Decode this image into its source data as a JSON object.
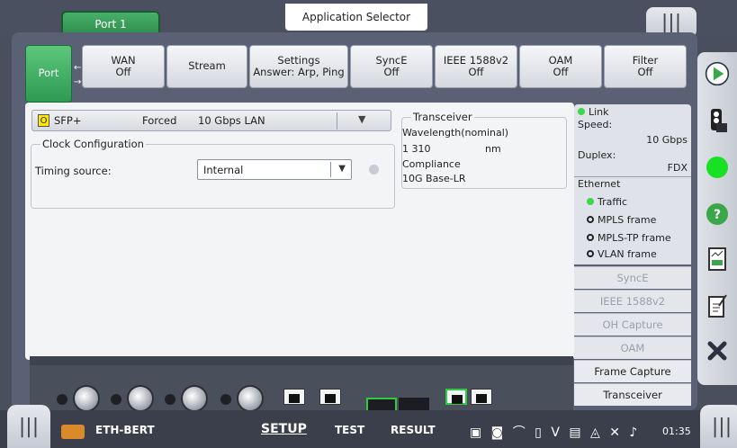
{
  "header": {
    "port_tab": "Port 1",
    "app_selector": "Application Selector"
  },
  "tabs": [
    {
      "line1": "Port",
      "line2": ""
    },
    {
      "line1": "WAN",
      "line2": "Off"
    },
    {
      "line1": "Stream",
      "line2": ""
    },
    {
      "line1": "Settings",
      "line2": "Answer: Arp, Ping"
    },
    {
      "line1": "SyncE",
      "line2": "Off"
    },
    {
      "line1": "IEEE 1588v2",
      "line2": "Off"
    },
    {
      "line1": "OAM",
      "line2": "Off"
    },
    {
      "line1": "Filter",
      "line2": "Off"
    }
  ],
  "sfp": {
    "indicator": "O",
    "type": "SFP+",
    "mode": "Forced",
    "rate": "10 Gbps LAN"
  },
  "clock": {
    "title": "Clock Configuration",
    "timing_label": "Timing source:",
    "timing_value": "Internal"
  },
  "transceiver": {
    "title": "Transceiver",
    "wavelength_label": "Wavelength(nominal)",
    "wavelength_value": "1 310",
    "wavelength_unit": "nm",
    "compliance_label": "Compliance",
    "compliance_value": "10G Base-LR"
  },
  "status": {
    "link": "Link",
    "speed_label": "Speed:",
    "speed_value": "10 Gbps",
    "duplex_label": "Duplex:",
    "duplex_value": "FDX",
    "ethernet": "Ethernet",
    "traffic": "Traffic",
    "mpls": "MPLS frame",
    "mpls_tp": "MPLS-TP frame",
    "vlan": "VLAN frame"
  },
  "side_buttons": [
    "SyncE",
    "IEEE 1588v2",
    "OH Capture",
    "OAM",
    "Frame Capture",
    "Transceiver"
  ],
  "bottom": {
    "app_name": "ETH-BERT",
    "setup": "SETUP",
    "test": "TEST",
    "result": "RESULT",
    "time": "01:35"
  },
  "colors": {
    "accent_green": "#2e9a52",
    "link_green": "#3cd84a",
    "panel": "#5a6175"
  }
}
